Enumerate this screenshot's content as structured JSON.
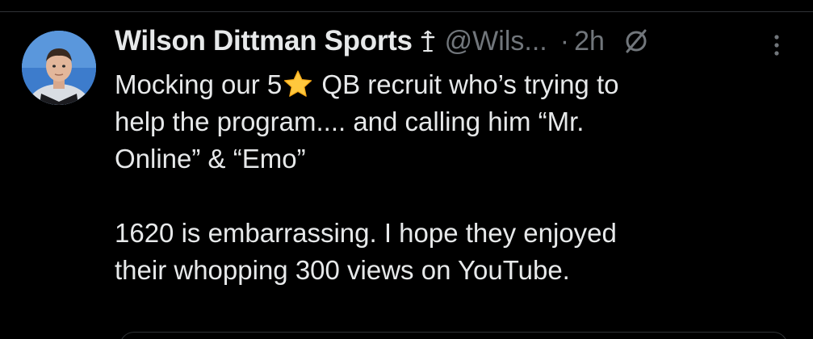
{
  "post": {
    "author": {
      "display_name": "Wilson Dittman Sports",
      "badge_icon": "cross-icon",
      "handle": "@Wils...",
      "avatar_icon": "avatar"
    },
    "separator": "·",
    "time": "2h",
    "text_lines_1": {
      "line1_before": "Mocking our 5",
      "line1_emoji": "star-icon",
      "line1_after": " QB recruit who’s trying to",
      "line2": "help the program.... and calling him “Mr.",
      "line3": "Online” & “Emo”"
    },
    "text_lines_2": {
      "line1": "1620 is embarrassing. I hope they enjoyed",
      "line2": "their whopping 300 views on YouTube."
    }
  },
  "colors": {
    "background": "#000000",
    "primary_text": "#e7e9ea",
    "secondary_text": "#71767b",
    "divider": "#2f3336",
    "star": "#ffc83d"
  }
}
